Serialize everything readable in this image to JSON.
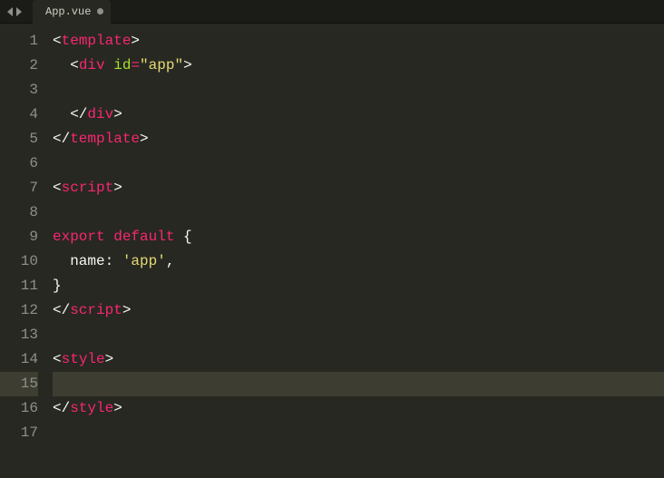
{
  "tab": {
    "filename": "App.vue",
    "dirty": true
  },
  "editor": {
    "currentLine": 15,
    "lines": [
      {
        "n": 1,
        "indent": 0,
        "tokens": [
          [
            "tagang",
            "<"
          ],
          [
            "tagname",
            "template"
          ],
          [
            "tagang",
            ">"
          ]
        ]
      },
      {
        "n": 2,
        "indent": 1,
        "tokens": [
          [
            "tagang",
            "<"
          ],
          [
            "tagname",
            "div"
          ],
          [
            "punct",
            " "
          ],
          [
            "attr",
            "id"
          ],
          [
            "op",
            "="
          ],
          [
            "str",
            "\"app\""
          ],
          [
            "tagang",
            ">"
          ]
        ]
      },
      {
        "n": 3,
        "indent": 0,
        "tokens": []
      },
      {
        "n": 4,
        "indent": 1,
        "tokens": [
          [
            "tagang",
            "</"
          ],
          [
            "tagname",
            "div"
          ],
          [
            "tagang",
            ">"
          ]
        ]
      },
      {
        "n": 5,
        "indent": 0,
        "tokens": [
          [
            "tagang",
            "</"
          ],
          [
            "tagname",
            "template"
          ],
          [
            "tagang",
            ">"
          ]
        ]
      },
      {
        "n": 6,
        "indent": 0,
        "tokens": []
      },
      {
        "n": 7,
        "indent": 0,
        "tokens": [
          [
            "tagang",
            "<"
          ],
          [
            "tagname",
            "script"
          ],
          [
            "tagang",
            ">"
          ]
        ]
      },
      {
        "n": 8,
        "indent": 0,
        "tokens": []
      },
      {
        "n": 9,
        "indent": 0,
        "tokens": [
          [
            "kw",
            "export"
          ],
          [
            "punct",
            " "
          ],
          [
            "kw",
            "default"
          ],
          [
            "punct",
            " {"
          ]
        ]
      },
      {
        "n": 10,
        "indent": 1,
        "tokens": [
          [
            "ident",
            "name"
          ],
          [
            "punct",
            ": "
          ],
          [
            "str",
            "'app'"
          ],
          [
            "punct",
            ","
          ]
        ]
      },
      {
        "n": 11,
        "indent": 0,
        "tokens": [
          [
            "punct",
            "}"
          ]
        ]
      },
      {
        "n": 12,
        "indent": 0,
        "tokens": [
          [
            "tagang",
            "</"
          ],
          [
            "tagname",
            "script"
          ],
          [
            "tagang",
            ">"
          ]
        ]
      },
      {
        "n": 13,
        "indent": 0,
        "tokens": []
      },
      {
        "n": 14,
        "indent": 0,
        "tokens": [
          [
            "tagang",
            "<"
          ],
          [
            "tagname",
            "style"
          ],
          [
            "tagang",
            ">"
          ]
        ]
      },
      {
        "n": 15,
        "indent": 0,
        "tokens": []
      },
      {
        "n": 16,
        "indent": 0,
        "tokens": [
          [
            "tagang",
            "</"
          ],
          [
            "tagname",
            "style"
          ],
          [
            "tagang",
            ">"
          ]
        ]
      },
      {
        "n": 17,
        "indent": 0,
        "tokens": []
      }
    ]
  }
}
